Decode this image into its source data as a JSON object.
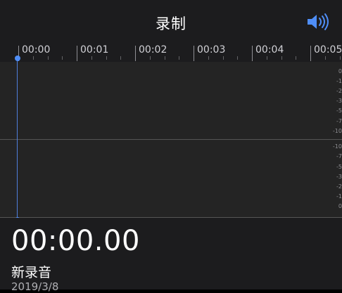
{
  "header": {
    "title": "录制",
    "speaker_icon": "speaker-volume-icon",
    "accent_color": "#4f8ef7"
  },
  "timeline": {
    "ticks": [
      "00:00",
      "00:01",
      "00:02",
      "00:03",
      "00:04",
      "00:05"
    ]
  },
  "waveform": {
    "db_scale_top": [
      "0",
      "-1",
      "-2",
      "-3",
      "-5",
      "-7",
      "-10"
    ],
    "db_scale_bottom": [
      "-10",
      "-7",
      "-5",
      "-3",
      "-2",
      "-1",
      "0"
    ]
  },
  "recording": {
    "elapsed": "00:00.00",
    "name": "新录音",
    "date": "2019/3/8"
  }
}
